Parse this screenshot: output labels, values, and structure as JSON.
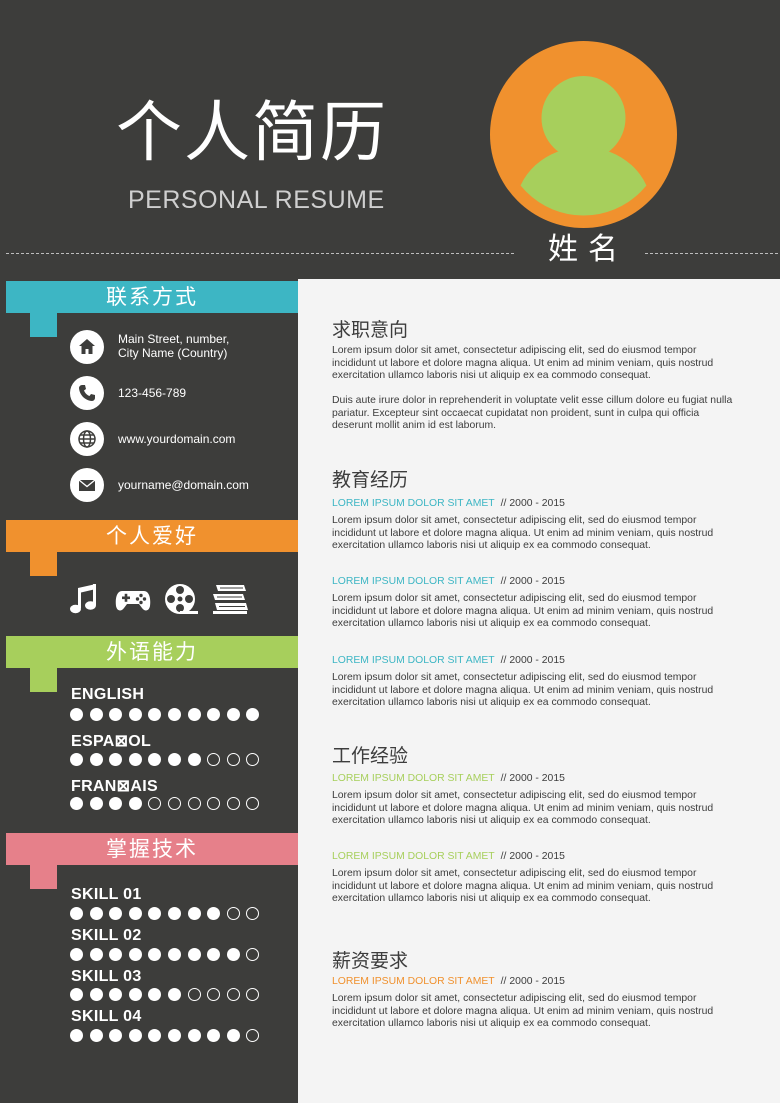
{
  "header": {
    "title_cn": "个人简历",
    "title_en": "PERSONAL RESUME",
    "name": "姓名"
  },
  "colors": {
    "background_dark": "#3d3d3b",
    "panel_light": "#f4f4f4",
    "teal": "#3db6c4",
    "orange": "#f0912e",
    "green": "#a7cf5c",
    "pink": "#e6808a",
    "avatar_ring": "#f0912e",
    "avatar_figure": "#a7cf5c"
  },
  "sidebar": {
    "contact": {
      "title": "联系方式",
      "address_line1": "Main Street, number,",
      "address_line2": "City Name (Country)",
      "phone": "123-456-789",
      "website": "www.yourdomain.com",
      "email": "yourname@domain.com",
      "icons": [
        "home-icon",
        "phone-icon",
        "globe-icon",
        "mail-icon"
      ]
    },
    "hobbies": {
      "title": "个人爱好",
      "icons": [
        "music-icon",
        "gamepad-icon",
        "film-reel-icon",
        "books-icon"
      ]
    },
    "languages": {
      "title": "外语能力",
      "items": [
        {
          "name": "ENGLISH",
          "level": 10,
          "max": 10
        },
        {
          "name": "ESPA⊠OL",
          "level": 7,
          "max": 10
        },
        {
          "name": "FRAN⊠AIS",
          "level": 4,
          "max": 10
        }
      ]
    },
    "skills": {
      "title": "掌握技术",
      "items": [
        {
          "name": "SKILL 01",
          "level": 8,
          "max": 10
        },
        {
          "name": "SKILL 02",
          "level": 9,
          "max": 10
        },
        {
          "name": "SKILL 03",
          "level": 6,
          "max": 10
        },
        {
          "name": "SKILL 04",
          "level": 9,
          "max": 10
        }
      ]
    }
  },
  "main": {
    "objective": {
      "title": "求职意向",
      "para1": "Lorem ipsum dolor sit amet, consectetur adipiscing elit, sed do eiusmod tempor incididunt ut labore et dolore magna aliqua. Ut enim ad minim veniam, quis nostrud exercitation ullamco laboris nisi ut aliquip ex ea commodo consequat.",
      "para2": "Duis aute irure dolor in reprehenderit in voluptate velit esse cillum dolore eu fugiat nulla pariatur. Excepteur sint occaecat cupidatat non proident, sunt in culpa qui officia deserunt mollit anim id est laborum."
    },
    "education": {
      "title": "教育经历",
      "entries": [
        {
          "heading": "LOREM IPSUM DOLOR SIT AMET",
          "sep": "//",
          "years": "2000 - 2015",
          "text": "Lorem ipsum dolor sit amet, consectetur adipiscing elit, sed do eiusmod tempor incididunt ut labore et dolore magna aliqua. Ut enim ad minim veniam, quis nostrud exercitation ullamco laboris nisi ut aliquip ex ea commodo consequat."
        },
        {
          "heading": "LOREM IPSUM DOLOR SIT AMET",
          "sep": "//",
          "years": "2000 - 2015",
          "text": "Lorem ipsum dolor sit amet, consectetur adipiscing elit, sed do eiusmod tempor incididunt ut labore et dolore magna aliqua. Ut enim ad minim veniam, quis nostrud exercitation ullamco laboris nisi ut aliquip ex ea commodo consequat."
        },
        {
          "heading": "LOREM IPSUM DOLOR SIT AMET",
          "sep": "//",
          "years": "2000 - 2015",
          "text": "Lorem ipsum dolor sit amet, consectetur adipiscing elit, sed do eiusmod tempor incididunt ut labore et dolore magna aliqua. Ut enim ad minim veniam, quis nostrud exercitation ullamco laboris nisi ut aliquip ex ea commodo consequat."
        }
      ]
    },
    "work": {
      "title": "工作经验",
      "entries": [
        {
          "heading": "LOREM IPSUM DOLOR SIT AMET",
          "sep": "//",
          "years": "2000 - 2015",
          "text": "Lorem ipsum dolor sit amet, consectetur adipiscing elit, sed do eiusmod tempor incididunt ut labore et dolore magna aliqua. Ut enim ad minim veniam, quis nostrud exercitation ullamco laboris nisi ut aliquip ex ea commodo consequat."
        },
        {
          "heading": "LOREM IPSUM DOLOR SIT AMET",
          "sep": "//",
          "years": "2000 - 2015",
          "text": "Lorem ipsum dolor sit amet, consectetur adipiscing elit, sed do eiusmod tempor incididunt ut labore et dolore magna aliqua. Ut enim ad minim veniam, quis nostrud exercitation ullamco laboris nisi ut aliquip ex ea commodo consequat."
        }
      ]
    },
    "salary": {
      "title": "薪资要求",
      "entries": [
        {
          "heading": "LOREM IPSUM DOLOR SIT AMET",
          "sep": "//",
          "years": "2000 - 2015",
          "text": "Lorem ipsum dolor sit amet, consectetur adipiscing elit, sed do eiusmod tempor incididunt ut labore et dolore magna aliqua. Ut enim ad minim veniam, quis nostrud exercitation ullamco laboris nisi ut aliquip ex ea commodo consequat."
        }
      ]
    }
  }
}
